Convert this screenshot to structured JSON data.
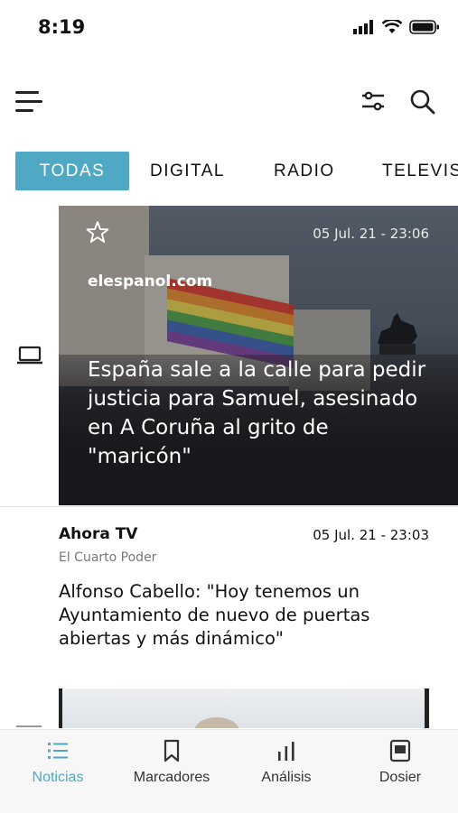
{
  "status_bar": {
    "time": "8:19"
  },
  "tabs": [
    {
      "label": "TODAS",
      "active": true
    },
    {
      "label": "DIGITAL",
      "active": false
    },
    {
      "label": "RADIO",
      "active": false
    },
    {
      "label": "TELEVIS",
      "active": false
    }
  ],
  "feed": {
    "featured": {
      "date": "05 Jul. 21 - 23:06",
      "source": "elespanol.com",
      "headline": "España sale a la calle para pedir justicia para Samuel, asesinado en A Coruña al grito de \"maricón\"",
      "media_icon": "laptop-icon"
    },
    "item2": {
      "source": "Ahora TV",
      "program": "El Cuarto Poder",
      "date": "05 Jul. 21 - 23:03",
      "headline": "Alfonso Cabello: \"Hoy tenemos un Ayuntamiento de nuevo de puertas abiertas y más dinámico\""
    }
  },
  "bottom_nav": [
    {
      "label": "Noticias",
      "icon": "list-icon",
      "active": true
    },
    {
      "label": "Marcadores",
      "icon": "bookmark-icon",
      "active": false
    },
    {
      "label": "Análisis",
      "icon": "bar-chart-icon",
      "active": false
    },
    {
      "label": "Dosier",
      "icon": "document-icon",
      "active": false
    }
  ],
  "colors": {
    "accent": "#4fa8c4"
  }
}
